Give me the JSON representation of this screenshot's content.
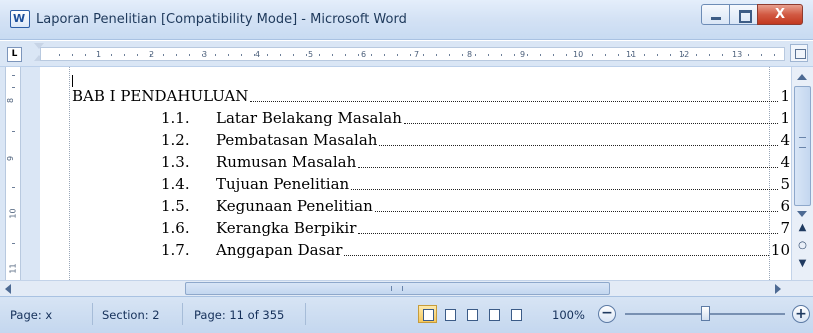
{
  "window": {
    "title": "Laporan Penelitian [Compatibility Mode] - Microsoft Word",
    "close_label": "X"
  },
  "ruler": {
    "tab_selector": "L",
    "h_ticks": [
      "1",
      "2",
      "3",
      "4",
      "5",
      "6",
      "7",
      "8",
      "9",
      "10",
      "11",
      "12",
      "13"
    ],
    "v_ticks": [
      "8",
      "9",
      "10",
      "11"
    ]
  },
  "document": {
    "toc": [
      {
        "num": "",
        "label": "BAB I PENDAHULUAN",
        "page": "1"
      },
      {
        "num": "1.1.",
        "label": "Latar Belakang Masalah",
        "page": "1"
      },
      {
        "num": "1.2.",
        "label": "Pembatasan Masalah",
        "page": "4"
      },
      {
        "num": "1.3.",
        "label": "Rumusan Masalah",
        "page": "4"
      },
      {
        "num": "1.4.",
        "label": "Tujuan Penelitian",
        "page": "5"
      },
      {
        "num": "1.5.",
        "label": "Kegunaan Penelitian",
        "page": "6"
      },
      {
        "num": "1.6.",
        "label": "Kerangka Berpikir",
        "page": "7"
      },
      {
        "num": "1.7.",
        "label": "Anggapan Dasar",
        "page": "10"
      }
    ]
  },
  "status_bar": {
    "page": "Page: x",
    "section": "Section: 2",
    "page_of": "Page: 11 of 355",
    "zoom": "100%",
    "zoom_out": "−",
    "zoom_in": "+"
  },
  "colors": {
    "titlebar": "#d2e1f4",
    "close_button": "#c2381f",
    "status_bar": "#c4d7ef"
  }
}
